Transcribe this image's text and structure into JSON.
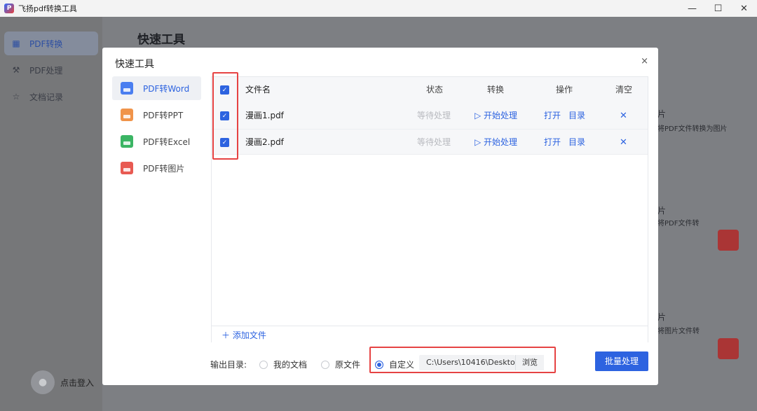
{
  "window": {
    "title": "飞扬pdf转换工具",
    "controls": [
      "—",
      "☐",
      "✕"
    ]
  },
  "background": {
    "sidebar": [
      {
        "label": "PDF转换",
        "icon": "grid-icon",
        "active": true
      },
      {
        "label": "PDF处理",
        "icon": "tool-icon",
        "active": false
      },
      {
        "label": "文档记录",
        "icon": "star-icon",
        "active": false
      }
    ],
    "login_label": "点击登入",
    "page_title": "快速工具",
    "snippets": [
      "片",
      "将PDF文件转换为图片",
      "片",
      "将PDF文件转",
      "片",
      "将图片文件转"
    ]
  },
  "modal": {
    "title": "快速工具",
    "close": "×",
    "side_items": [
      {
        "label": "PDF转Word",
        "color": "#4a7ef0"
      },
      {
        "label": "PDF转PPT",
        "color": "#f0944a"
      },
      {
        "label": "PDF转Excel",
        "color": "#3bb564"
      },
      {
        "label": "PDF转图片",
        "color": "#e85a52"
      }
    ],
    "table": {
      "headers": {
        "name": "文件名",
        "status": "状态",
        "convert": "转换",
        "operation": "操作",
        "clear": "清空"
      },
      "rows": [
        {
          "name": "漫画1.pdf",
          "status": "等待处理",
          "convert": "▷ 开始处理",
          "open": "打开",
          "dir": "目录",
          "clear": "✕",
          "checked": true
        },
        {
          "name": "漫画2.pdf",
          "status": "等待处理",
          "convert": "▷ 开始处理",
          "open": "打开",
          "dir": "目录",
          "clear": "✕",
          "checked": true
        }
      ],
      "add_file": "＋ 添加文件"
    },
    "output": {
      "label": "输出目录:",
      "options": [
        {
          "label": "我的文档",
          "selected": false
        },
        {
          "label": "原文件",
          "selected": false
        },
        {
          "label": "自定义",
          "selected": true
        }
      ],
      "path": "C:\\Users\\10416\\Deskto",
      "browse": "浏览"
    },
    "batch_button": "批量处理"
  },
  "colors": {
    "accent": "#2d63e0",
    "highlight": "#e64343"
  }
}
